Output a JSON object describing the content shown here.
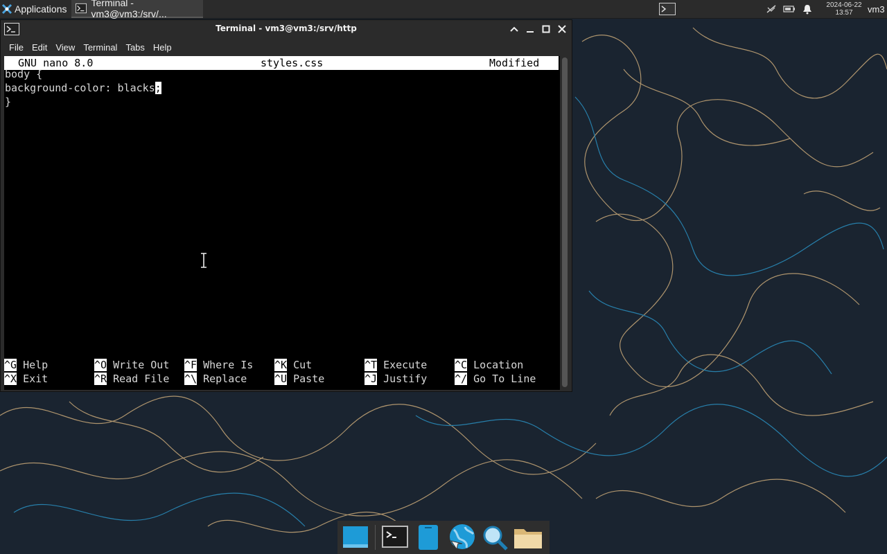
{
  "top_panel": {
    "applications_label": "Applications",
    "task_title": "Terminal - vm3@vm3:/srv/...",
    "clock_date": "2024-06-22",
    "clock_time": "13:57",
    "user": "vm3"
  },
  "window": {
    "title": "Terminal - vm3@vm3:/srv/http",
    "menu": [
      "File",
      "Edit",
      "View",
      "Terminal",
      "Tabs",
      "Help"
    ]
  },
  "nano": {
    "version": "GNU nano 8.0",
    "filename": "styles.css",
    "status": "Modified",
    "lines": [
      "body {",
      "background-color: blacks",
      ";",
      "}"
    ],
    "shortcuts": [
      {
        "key": "^G",
        "label": "Help"
      },
      {
        "key": "^O",
        "label": "Write Out"
      },
      {
        "key": "^F",
        "label": "Where Is"
      },
      {
        "key": "^K",
        "label": "Cut"
      },
      {
        "key": "^T",
        "label": "Execute"
      },
      {
        "key": "^C",
        "label": "Location"
      },
      {
        "key": "^X",
        "label": "Exit"
      },
      {
        "key": "^R",
        "label": "Read File"
      },
      {
        "key": "^\\",
        "label": "Replace"
      },
      {
        "key": "^U",
        "label": "Paste"
      },
      {
        "key": "^J",
        "label": "Justify"
      },
      {
        "key": "^/",
        "label": "Go To Line"
      }
    ]
  },
  "dock": [
    "desktop-icon",
    "terminal-icon",
    "files-phone-icon",
    "web-browser-icon",
    "search-icon",
    "folder-icon"
  ],
  "colors": {
    "panel": "#2b2b2b",
    "wallpaper": "#1a2430",
    "accent_blue": "#1e9bd7"
  }
}
